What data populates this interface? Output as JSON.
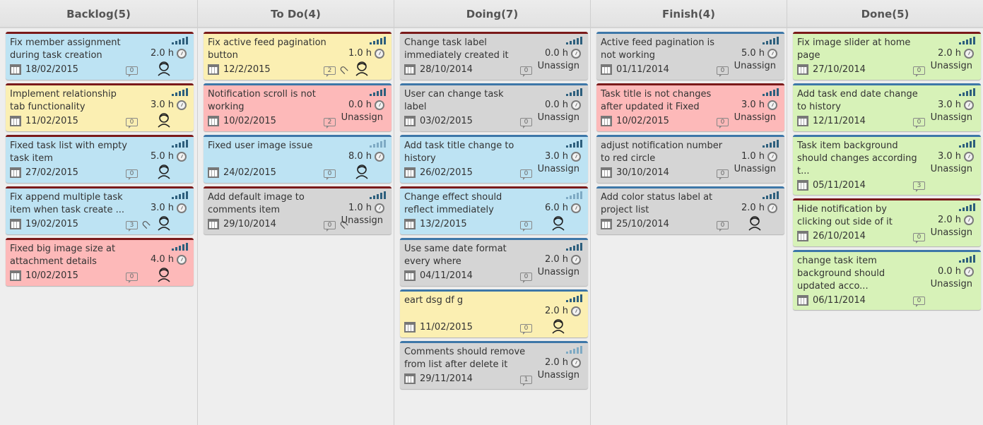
{
  "columns": [
    {
      "header": "Backlog(5)",
      "cards": [
        {
          "title": "Fix member assignment during task creation",
          "hours": "2.0 h",
          "date": "18/02/2015",
          "comments": "0",
          "color": "blue",
          "top": "red",
          "assignee": "avatar",
          "attachment": false,
          "signal": "dark"
        },
        {
          "title": "Implement relationship tab functionality",
          "hours": "3.0 h",
          "date": "11/02/2015",
          "comments": "0",
          "color": "yellow",
          "top": "red",
          "assignee": "avatar",
          "attachment": false,
          "signal": "dark"
        },
        {
          "title": "Fixed task list with empty task item",
          "hours": "5.0 h",
          "date": "27/02/2015",
          "comments": "0",
          "color": "blue",
          "top": "red",
          "assignee": "avatar",
          "attachment": false,
          "signal": "dark"
        },
        {
          "title": "Fix append multiple task item when task create ...",
          "hours": "3.0 h",
          "date": "19/02/2015",
          "comments": "3",
          "color": "blue",
          "top": "red",
          "assignee": "avatar",
          "attachment": true,
          "signal": "dark"
        },
        {
          "title": "Fixed big image size at attachment details",
          "hours": "4.0 h",
          "date": "10/02/2015",
          "comments": "0",
          "color": "red",
          "top": "red",
          "assignee": "avatar",
          "attachment": false,
          "signal": "dark"
        }
      ]
    },
    {
      "header": "To Do(4)",
      "cards": [
        {
          "title": "Fix active feed pagination button",
          "hours": "1.0 h",
          "date": "12/2/2015",
          "comments": "2",
          "color": "yellow",
          "top": "red",
          "assignee": "avatar",
          "attachment": true,
          "signal": "dark"
        },
        {
          "title": "Notification scroll is not working",
          "hours": "0.0 h",
          "date": "10/02/2015",
          "comments": "2",
          "color": "red",
          "top": "blue",
          "assignee": "Unassign",
          "attachment": false,
          "signal": "dark"
        },
        {
          "title": "Fixed user image issue",
          "hours": "8.0 h",
          "date": "24/02/2015",
          "comments": "0",
          "color": "blue",
          "top": "blue",
          "assignee": "avatar",
          "attachment": false,
          "signal": "light"
        },
        {
          "title": "Add default image to comments item",
          "hours": "1.0 h",
          "date": "29/10/2014",
          "comments": "0",
          "color": "gray",
          "top": "red",
          "assignee": "Unassign",
          "attachment": true,
          "signal": "dark"
        }
      ]
    },
    {
      "header": "Doing(7)",
      "cards": [
        {
          "title": "Change task label immediately created it",
          "hours": "0.0 h",
          "date": "28/10/2014",
          "comments": "0",
          "color": "gray",
          "top": "red",
          "assignee": "Unassign",
          "attachment": false,
          "signal": "dark"
        },
        {
          "title": "User can change task label",
          "hours": "0.0 h",
          "date": "03/02/2015",
          "comments": "0",
          "color": "gray",
          "top": "blue",
          "assignee": "Unassign",
          "attachment": false,
          "signal": "dark"
        },
        {
          "title": "Add task title change to history",
          "hours": "3.0 h",
          "date": "26/02/2015",
          "comments": "0",
          "color": "blue",
          "top": "blue",
          "assignee": "Unassign",
          "attachment": false,
          "signal": "dark"
        },
        {
          "title": "Change effect should reflect immediately",
          "hours": "6.0 h",
          "date": "13/2/2015",
          "comments": "0",
          "color": "blue",
          "top": "red",
          "assignee": "avatar",
          "attachment": false,
          "signal": "light"
        },
        {
          "title": "Use same date format every where",
          "hours": "2.0 h",
          "date": "04/11/2014",
          "comments": "0",
          "color": "gray",
          "top": "blue",
          "assignee": "Unassign",
          "attachment": false,
          "signal": "dark"
        },
        {
          "title": "eart dsg df g",
          "hours": "2.0 h",
          "date": "11/02/2015",
          "comments": "0",
          "color": "yellow",
          "top": "blue",
          "assignee": "avatar",
          "attachment": false,
          "signal": "dark"
        },
        {
          "title": "Comments should remove from list after delete it",
          "hours": "2.0 h",
          "date": "29/11/2014",
          "comments": "1",
          "color": "gray",
          "top": "blue",
          "assignee": "Unassign",
          "attachment": false,
          "signal": "light"
        }
      ]
    },
    {
      "header": "Finish(4)",
      "cards": [
        {
          "title": "Active feed pagination is not working",
          "hours": "5.0 h",
          "date": "01/11/2014",
          "comments": "0",
          "color": "gray",
          "top": "blue",
          "assignee": "Unassign",
          "attachment": false,
          "signal": "dark"
        },
        {
          "title": "Task title is not changes after updated it Fixed",
          "hours": "3.0 h",
          "date": "10/02/2015",
          "comments": "0",
          "color": "red",
          "top": "red",
          "assignee": "Unassign",
          "attachment": false,
          "signal": "dark"
        },
        {
          "title": "adjust notification number to red circle",
          "hours": "1.0 h",
          "date": "30/10/2014",
          "comments": "0",
          "color": "gray",
          "top": "blue",
          "assignee": "Unassign",
          "attachment": false,
          "signal": "dark"
        },
        {
          "title": "Add color status label at project list",
          "hours": "2.0 h",
          "date": "25/10/2014",
          "comments": "0",
          "color": "gray",
          "top": "blue",
          "assignee": "avatar",
          "attachment": false,
          "signal": "dark"
        }
      ]
    },
    {
      "header": "Done(5)",
      "cards": [
        {
          "title": "Fix image slider at home page",
          "hours": "2.0 h",
          "date": "27/10/2014",
          "comments": "0",
          "color": "green",
          "top": "red",
          "assignee": "Unassign",
          "attachment": false,
          "signal": "dark"
        },
        {
          "title": "Add task end date change to history",
          "hours": "3.0 h",
          "date": "12/11/2014",
          "comments": "0",
          "color": "green",
          "top": "blue",
          "assignee": "Unassign",
          "attachment": false,
          "signal": "dark"
        },
        {
          "title": "Task item background should changes according t...",
          "hours": "3.0 h",
          "date": "05/11/2014",
          "comments": "3",
          "color": "green",
          "top": "blue",
          "assignee": "Unassign",
          "attachment": false,
          "signal": "dark"
        },
        {
          "title": "Hide notification by clicking out side of it",
          "hours": "2.0 h",
          "date": "26/10/2014",
          "comments": "0",
          "color": "green",
          "top": "red",
          "assignee": "Unassign",
          "attachment": false,
          "signal": "dark"
        },
        {
          "title": "change task item background should updated acco...",
          "hours": "0.0 h",
          "date": "06/11/2014",
          "comments": "0",
          "color": "green",
          "top": "blue",
          "assignee": "Unassign",
          "attachment": false,
          "signal": "dark"
        }
      ]
    }
  ]
}
